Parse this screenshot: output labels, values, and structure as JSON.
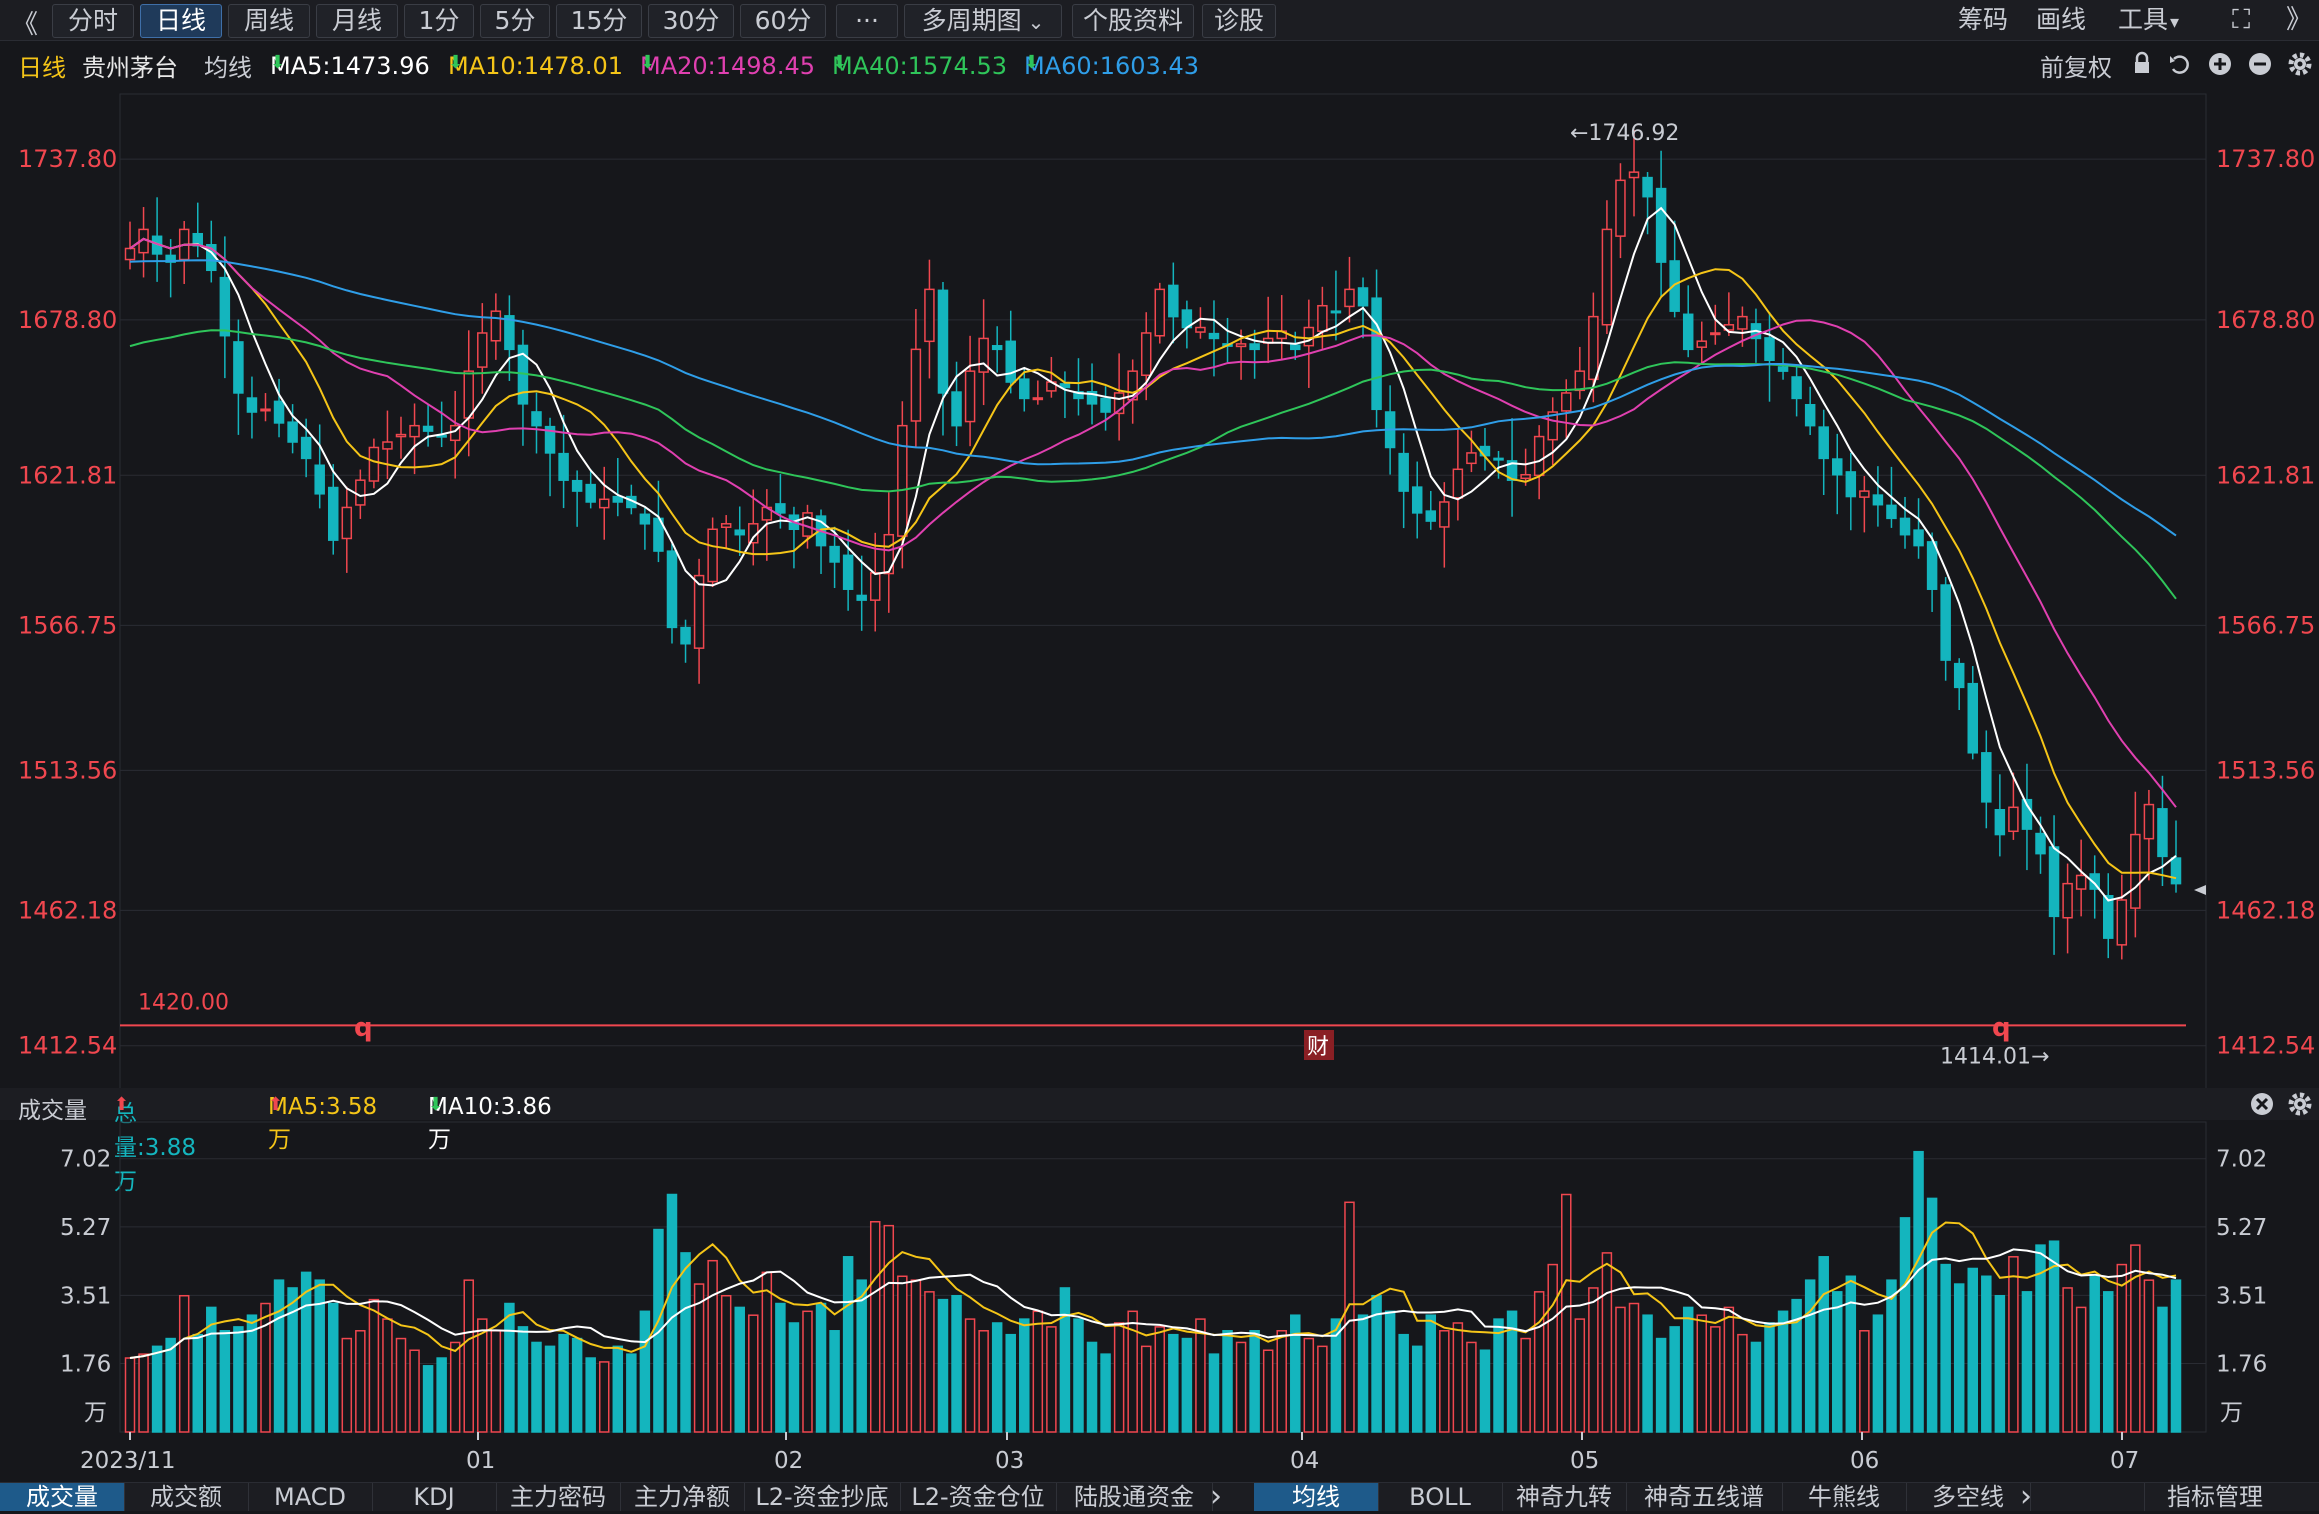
{
  "toolbar": {
    "collapse_glyph": "《",
    "tabs": [
      "分时",
      "日线",
      "周线",
      "月线",
      "1分",
      "5分",
      "15分",
      "30分",
      "60分",
      "···",
      "多周期图",
      "个股资料",
      "诊股"
    ],
    "active_tab": "日线",
    "multi_period_arrow": "⌄",
    "right": {
      "chips": "筹码",
      "draw": "画线",
      "tools": "工具",
      "tools_arrow": "▾",
      "fullscreen_glyph": "⛶",
      "expand_glyph": "》"
    }
  },
  "legend": {
    "period": "日线",
    "stock": "贵州茅台",
    "ma_label": "均线",
    "ma5": "MA5:1473.96",
    "ma10": "MA10:1478.01",
    "ma20": "MA20:1498.45",
    "ma40": "MA40:1574.53",
    "ma60": "MA60:1603.43",
    "down_arrow": "⬇",
    "adjust": "前复权"
  },
  "colors": {
    "up": "#f0474f",
    "down": "#14b5be",
    "ma5": "#ffffff",
    "ma10": "#f5c518",
    "ma20": "#e040b0",
    "ma40": "#2fc55a",
    "ma60": "#2f9ee8",
    "bg": "#16171b",
    "grid": "#2a2c33"
  },
  "price_axis": {
    "ticks": [
      "1737.80",
      "1678.80",
      "1621.81",
      "1566.75",
      "1513.56",
      "1462.18",
      "1412.54"
    ]
  },
  "annotations": {
    "high": "←1746.92",
    "low": "1414.01→",
    "hline": "1420.00",
    "q1": "q",
    "q2": "q",
    "cai": "财"
  },
  "volume": {
    "title": "成交量",
    "total": "总量:3.88万",
    "ma5": "MA5:3.58万",
    "ma10": "MA10:3.86万",
    "up_arrow": "⬆",
    "down_arrow": "⬇",
    "ticks": [
      "7.02",
      "5.27",
      "3.51",
      "1.76"
    ],
    "unit": "万"
  },
  "dates": [
    "2023/11",
    "01",
    "02",
    "03",
    "04",
    "05",
    "06",
    "07"
  ],
  "bottom_tabs_left": [
    "成交量",
    "成交额",
    "MACD",
    "KDJ",
    "主力密码",
    "主力净额",
    "L2-资金抄底",
    "L2-资金仓位",
    "陆股通资金"
  ],
  "bottom_tabs_right": [
    "均线",
    "BOLL",
    "神奇九转",
    "神奇五线谱",
    "牛熊线",
    "多空线"
  ],
  "bottom_nav_glyph": "›",
  "indicator_mgmt": "指标管理",
  "chart_data": {
    "type": "candlestick",
    "series_note": "贵州茅台 日线 前复权",
    "ylim": [
      1412.54,
      1737.8
    ],
    "yticks": [
      1737.8,
      1678.8,
      1621.81,
      1566.75,
      1513.56,
      1462.18,
      1412.54
    ],
    "hline": 1420.0,
    "high_mark": 1746.92,
    "low_mark": 1414.01,
    "close_series": [
      1705,
      1712,
      1703,
      1700,
      1712,
      1706,
      1697,
      1673,
      1652,
      1645,
      1646,
      1641,
      1634,
      1628,
      1615,
      1598,
      1610,
      1620,
      1632,
      1634,
      1636,
      1640,
      1638,
      1636,
      1640,
      1660,
      1674,
      1682,
      1668,
      1648,
      1640,
      1630,
      1620,
      1616,
      1612,
      1613,
      1612,
      1610,
      1604,
      1594,
      1566,
      1560,
      1585,
      1602,
      1604,
      1600,
      1604,
      1610,
      1608,
      1602,
      1608,
      1596,
      1590,
      1580,
      1576,
      1586,
      1600,
      1640,
      1668,
      1690,
      1652,
      1640,
      1660,
      1672,
      1668,
      1656,
      1650,
      1650,
      1656,
      1654,
      1650,
      1648,
      1645,
      1652,
      1660,
      1674,
      1690,
      1680,
      1676,
      1676,
      1672,
      1670,
      1670,
      1668,
      1672,
      1672,
      1668,
      1676,
      1684,
      1682,
      1690,
      1684,
      1646,
      1632,
      1616,
      1608,
      1605,
      1612,
      1624,
      1630,
      1629,
      1628,
      1620,
      1622,
      1636,
      1645,
      1652,
      1660,
      1680,
      1712,
      1730,
      1733,
      1724,
      1700,
      1682,
      1668,
      1671,
      1674,
      1677,
      1680,
      1672,
      1664,
      1660,
      1650,
      1640,
      1628,
      1622,
      1614,
      1616,
      1611,
      1606,
      1600,
      1596,
      1580,
      1554,
      1544,
      1520,
      1502,
      1490,
      1500,
      1492,
      1483,
      1460,
      1472,
      1475,
      1470,
      1452,
      1466,
      1490,
      1501,
      1482,
      1472
    ],
    "volume_ylim": [
      0,
      7.02
    ],
    "volume_ticks": [
      7.02,
      5.27,
      3.51,
      1.76
    ],
    "volume_series": [
      1.9,
      2.0,
      2.2,
      2.4,
      3.5,
      2.5,
      3.2,
      2.6,
      2.7,
      3.0,
      3.3,
      3.9,
      3.7,
      4.1,
      3.9,
      3.3,
      2.4,
      2.6,
      3.4,
      2.9,
      2.4,
      2.1,
      1.7,
      1.9,
      2.3,
      3.9,
      2.9,
      2.6,
      3.3,
      2.7,
      2.3,
      2.2,
      2.5,
      2.4,
      1.9,
      1.8,
      2.2,
      2.0,
      3.1,
      5.2,
      6.1,
      4.6,
      3.8,
      4.4,
      3.5,
      3.2,
      3.0,
      4.1,
      3.3,
      2.8,
      3.1,
      3.3,
      2.6,
      4.5,
      3.9,
      5.4,
      5.3,
      4.0,
      3.9,
      3.6,
      3.4,
      3.5,
      2.9,
      2.6,
      2.8,
      2.5,
      2.9,
      3.1,
      2.7,
      3.7,
      2.9,
      2.3,
      2.0,
      2.8,
      3.1,
      2.2,
      2.7,
      2.5,
      2.4,
      2.9,
      2.0,
      2.6,
      2.3,
      2.6,
      2.1,
      2.6,
      3.0,
      2.4,
      2.2,
      2.9,
      5.9,
      3.0,
      3.5,
      3.1,
      2.5,
      2.2,
      3.0,
      2.6,
      2.8,
      2.3,
      2.1,
      2.9,
      3.1,
      2.4,
      3.6,
      4.3,
      6.1,
      2.9,
      3.7,
      4.6,
      3.2,
      3.3,
      3.0,
      2.4,
      2.7,
      3.2,
      3.0,
      2.7,
      3.2,
      2.5,
      2.3,
      2.8,
      3.1,
      3.4,
      3.9,
      4.5,
      3.6,
      4.0,
      2.6,
      3.0,
      3.9,
      5.5,
      7.2,
      6.0,
      4.3,
      3.8,
      4.2,
      4.0,
      3.5,
      4.5,
      3.6,
      4.8,
      4.9,
      3.7,
      3.2,
      4.0,
      3.6,
      4.3,
      4.8,
      3.9,
      3.2,
      3.9
    ]
  }
}
